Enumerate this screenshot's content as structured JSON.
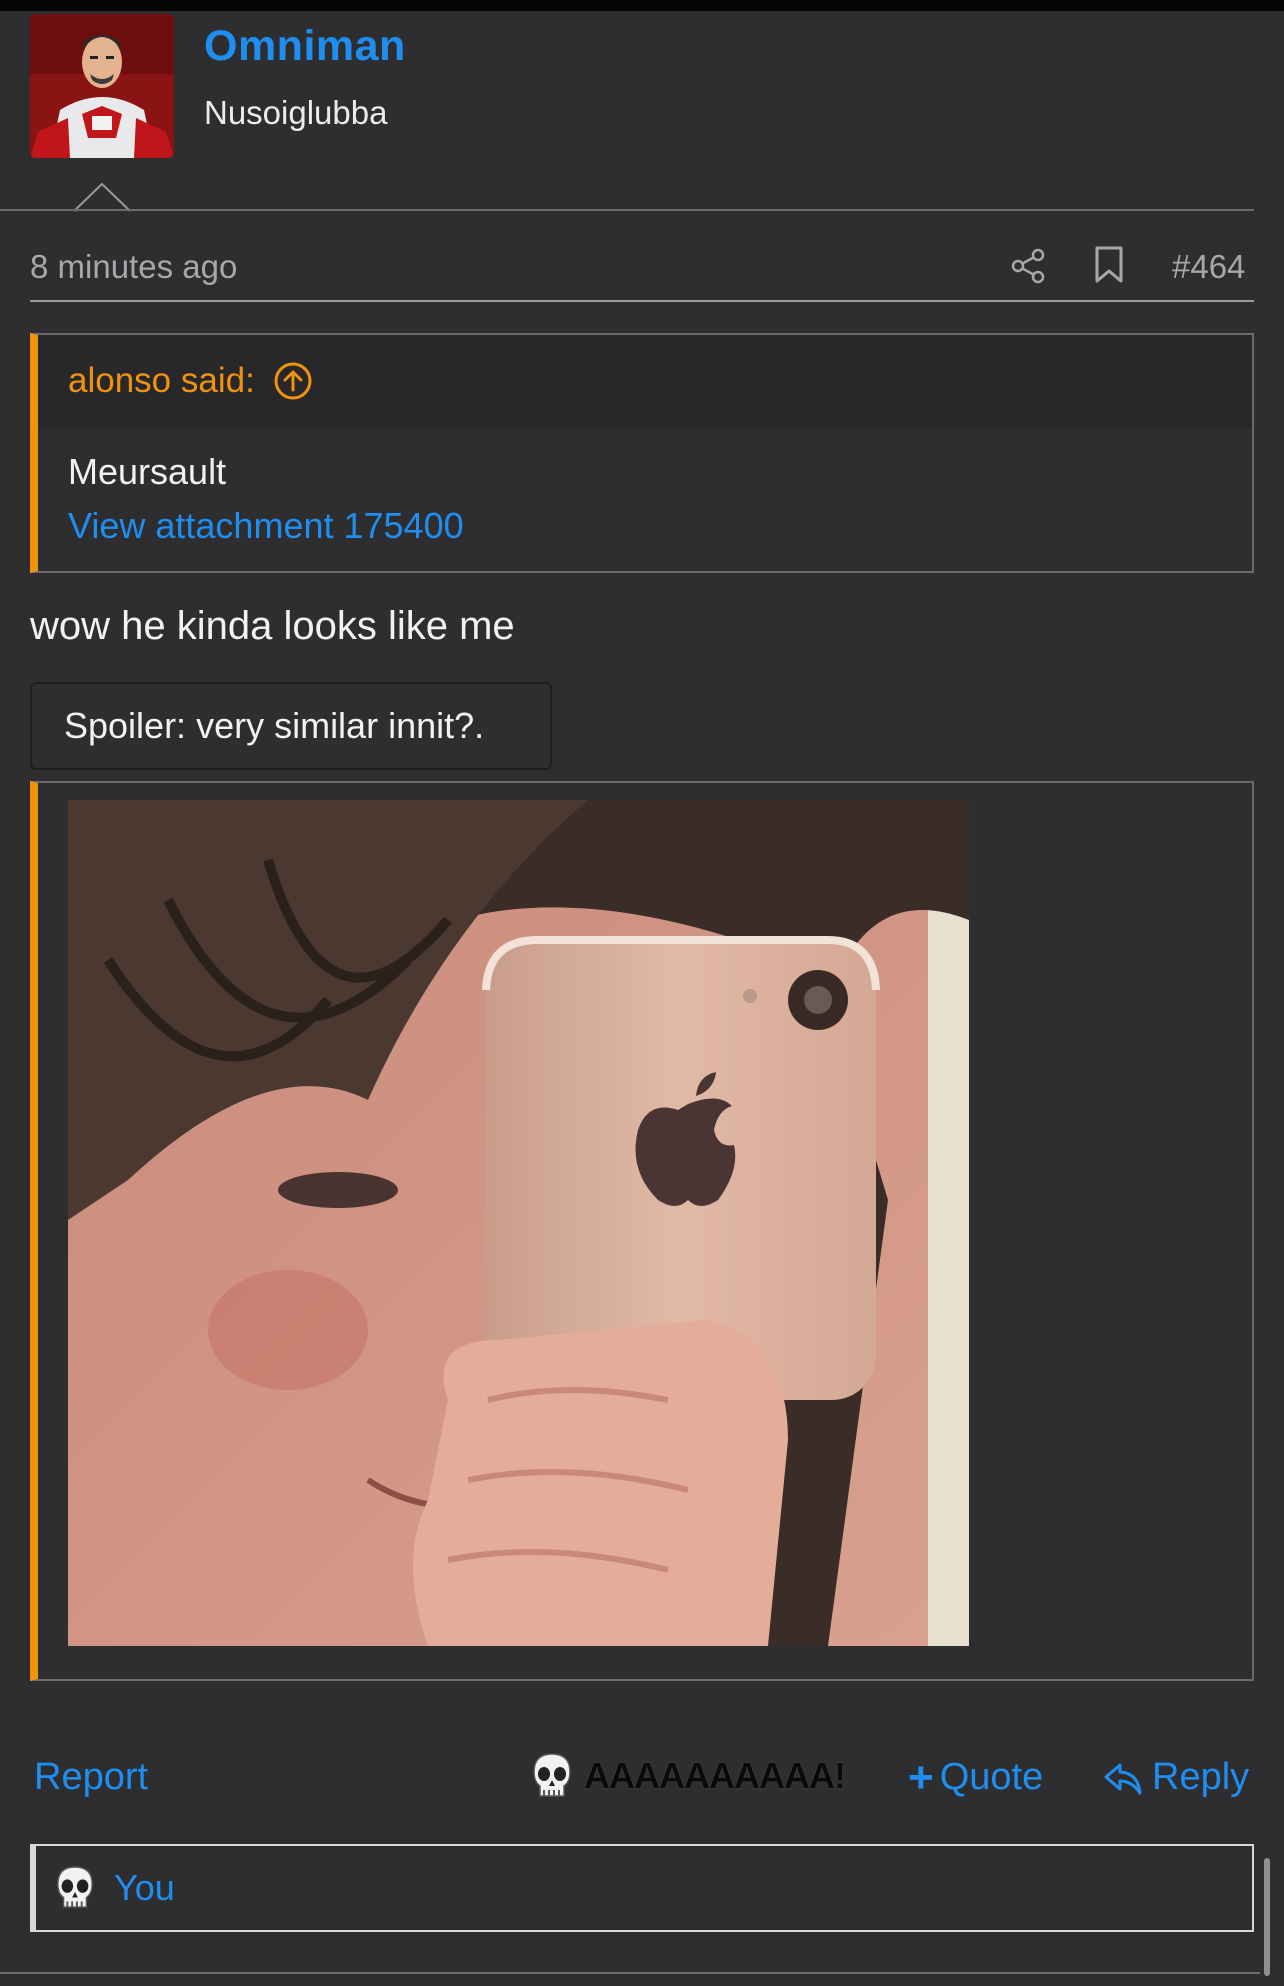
{
  "post": {
    "author": "Omniman",
    "author_title": "Nusoiglubba",
    "time": "8 minutes ago",
    "number": "#464"
  },
  "quote": {
    "attribution": "alonso said:",
    "text": "Meursault",
    "link": "View attachment 175400"
  },
  "message": {
    "text": "wow he kinda looks like me",
    "spoiler_label": "Spoiler: very similar innit?."
  },
  "actions": {
    "report": "Report",
    "reaction": "AAAAAAAAAA!",
    "quote": "Quote",
    "quote_prefix": "+",
    "reply": "Reply"
  },
  "reactions": {
    "user": "You"
  },
  "colors": {
    "background": "#2e2d30",
    "link": "#1f8ef1",
    "quote_accent": "#f0930e"
  },
  "icons": [
    "avatar",
    "share-icon",
    "bookmark-icon",
    "arrow-up-circle-icon",
    "skull-icon",
    "reply-arrow-icon"
  ]
}
